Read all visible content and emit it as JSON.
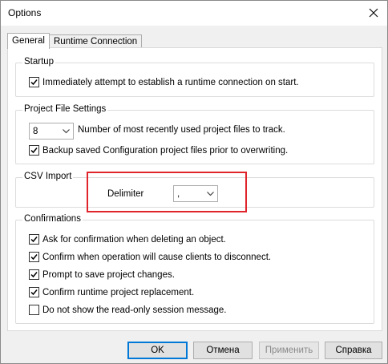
{
  "window": {
    "title": "Options"
  },
  "tabs": [
    {
      "label": "General",
      "active": true
    },
    {
      "label": "Runtime Connection",
      "active": false
    }
  ],
  "startup": {
    "title": "Startup",
    "auto_connect": {
      "label": "Immediately attempt to establish a runtime connection on start.",
      "checked": true
    }
  },
  "project_file_settings": {
    "title": "Project File Settings",
    "recent_count": {
      "value": "8"
    },
    "recent_label": "Number of most recently used project files to track.",
    "backup": {
      "label": "Backup saved Configuration project files prior to overwriting.",
      "checked": true
    }
  },
  "csv_import": {
    "title": "CSV Import",
    "delimiter_label": "Delimiter",
    "delimiter_value": ","
  },
  "confirmations": {
    "title": "Confirmations",
    "items": [
      {
        "label": "Ask for confirmation when deleting an object.",
        "checked": true
      },
      {
        "label": "Confirm when operation will cause clients to disconnect.",
        "checked": true
      },
      {
        "label": "Prompt to save project changes.",
        "checked": true
      },
      {
        "label": "Confirm runtime project replacement.",
        "checked": true
      },
      {
        "label": "Do not show the read-only session message.",
        "checked": false
      }
    ]
  },
  "buttons": {
    "ok": "OK",
    "cancel": "Отмена",
    "apply": "Применить",
    "help": "Справка"
  },
  "colors": {
    "highlight": "#e0242b",
    "default_button_border": "#0078d7"
  },
  "icons": {
    "close": "close-icon",
    "dropdown": "chevron-down-icon",
    "check": "checkmark-icon"
  }
}
